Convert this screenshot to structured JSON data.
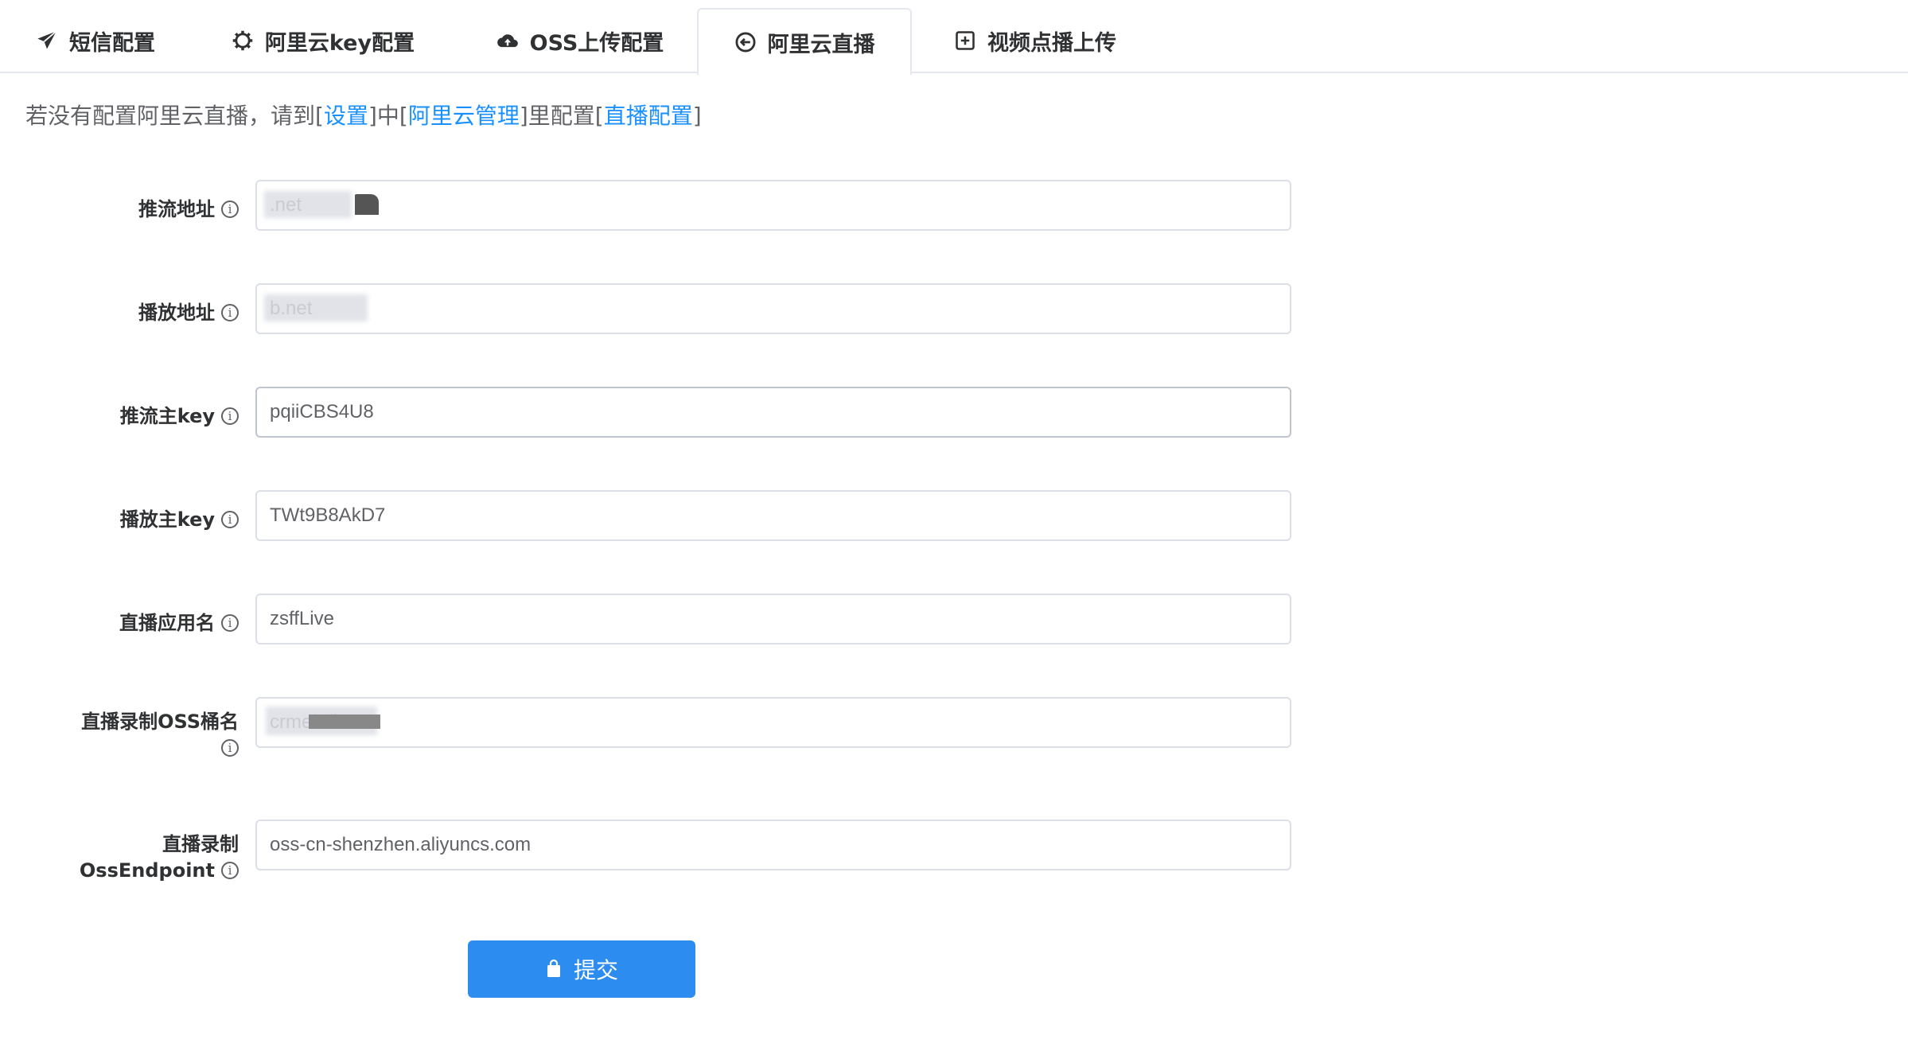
{
  "tabs": [
    {
      "label": "短信配置",
      "icon": "paper-plane-icon"
    },
    {
      "label": "阿里云key配置",
      "icon": "gear-icon"
    },
    {
      "label": "OSS上传配置",
      "icon": "cloud-upload-icon"
    },
    {
      "label": "阿里云直播",
      "icon": "circle-arrow-left-icon"
    },
    {
      "label": "视频点播上传",
      "icon": "plus-square-icon"
    }
  ],
  "active_tab": "阿里云直播",
  "notice": {
    "prefix": "若没有配置阿里云直播，请到[",
    "link1": "设置",
    "mid1": "]中[",
    "link2": "阿里云管理",
    "mid2": "]里配置[",
    "link3": "直播配置",
    "suffix": "]"
  },
  "form": {
    "push_domain": {
      "label": "推流地址",
      "value": ".net"
    },
    "play_domain": {
      "label": "播放地址",
      "value": "b.net"
    },
    "push_key": {
      "label": "推流主key",
      "value": "pqiiCBS4U8"
    },
    "play_key": {
      "label": "播放主key",
      "value": "TWt9B8AkD7"
    },
    "app_name": {
      "label": "直播应用名",
      "value": "zsffLive"
    },
    "oss_bucket": {
      "label": "直播录制OSS桶名",
      "value": "crmeb-live"
    },
    "oss_endpoint": {
      "label_line1": "直播录制",
      "label_line2": "OssEndpoint",
      "value": "oss-cn-shenzhen.aliyuncs.com"
    }
  },
  "submit_label": "提交",
  "colors": {
    "accent": "#2d8cf0",
    "link": "#1890ff",
    "border": "#dcdfe6"
  }
}
